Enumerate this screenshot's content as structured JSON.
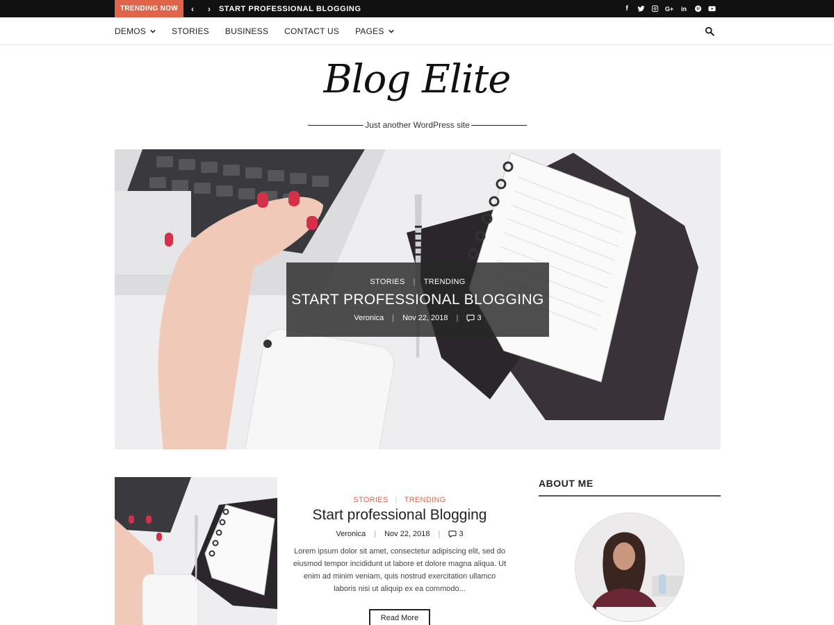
{
  "topbar": {
    "trending_label": "TRENDING NOW",
    "prev_icon": "chevron-left-icon",
    "next_icon": "chevron-right-icon",
    "ticker_text": "START PROFESSIONAL BLOGGING",
    "social_icons": [
      "facebook-icon",
      "twitter-icon",
      "instagram-icon",
      "google-plus-icon",
      "linkedin-icon",
      "pinterest-icon",
      "youtube-icon"
    ]
  },
  "nav": {
    "items": [
      {
        "label": "DEMOS",
        "has_dropdown": true
      },
      {
        "label": "STORIES",
        "has_dropdown": false
      },
      {
        "label": "BUSINESS",
        "has_dropdown": false
      },
      {
        "label": "CONTACT US",
        "has_dropdown": false
      },
      {
        "label": "PAGES",
        "has_dropdown": true
      }
    ],
    "search_icon": "search-icon"
  },
  "site": {
    "title": "Blog Elite",
    "tagline": "Just another WordPress site"
  },
  "hero": {
    "categories": [
      "STORIES",
      "TRENDING"
    ],
    "title": "START PROFESSIONAL BLOGGING",
    "author": "Veronica",
    "date": "Nov 22, 2018",
    "comments": "3"
  },
  "post": {
    "categories": [
      "STORIES",
      "TRENDING"
    ],
    "title": "Start professional Blogging",
    "author": "Veronica",
    "date": "Nov 22, 2018",
    "comments": "3",
    "excerpt": "Lorem ipsum dolor sit amet, consectetur adipiscing elit, sed do eiusmod tempor incididunt ut labore et dolore magna aliqua. Ut enim ad minim veniam, quis nostrud exercitation ullamco laboris nisi ut aliquip ex ea commodo...",
    "read_more": "Read More"
  },
  "sidebar": {
    "about_title": "ABOUT ME"
  },
  "colors": {
    "accent": "#e0644a",
    "topbar_bg": "#111111",
    "overlay_bg": "#282828"
  }
}
